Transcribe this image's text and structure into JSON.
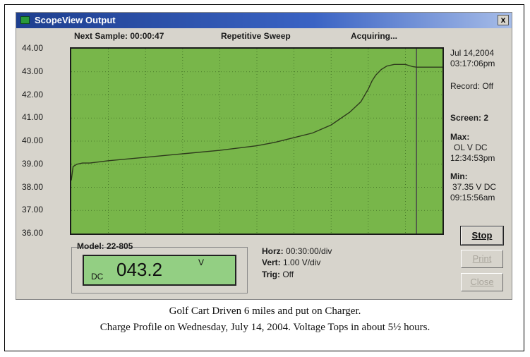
{
  "window": {
    "title": "ScopeView Output",
    "close_label": "x"
  },
  "status": {
    "next_sample": "Next Sample: 00:00:47",
    "mode": "Repetitive Sweep",
    "state": "Acquiring..."
  },
  "y_ticks": [
    "44.00",
    "43.00",
    "42.00",
    "41.00",
    "40.00",
    "39.00",
    "38.00",
    "37.00",
    "36.00"
  ],
  "side_panel": {
    "date": "Jul 14,2004",
    "time": "03:17:06pm",
    "record": "Record: Off",
    "screen": "Screen:  2",
    "max_label": "Max:",
    "max_value": "OL   V DC",
    "max_time": "12:34:53pm",
    "min_label": "Min:",
    "min_value": "37.35   V DC",
    "min_time": "09:15:56am"
  },
  "meter": {
    "model_label": "Model: 22-805",
    "mode": "DC",
    "reading": "043.2",
    "unit": "V"
  },
  "settings": {
    "horz_label": "Horz:",
    "horz_value": "00:30:00/div",
    "vert_label": "Vert:",
    "vert_value": "1.00 V/div",
    "trig_label": "Trig:",
    "trig_value": "Off"
  },
  "buttons": {
    "stop": "Stop",
    "print": "Print",
    "close": "Close"
  },
  "caption": {
    "line1": "Golf Cart Driven 6 miles and put on Charger.",
    "line2": "Charge Profile on Wednesday, July 14, 2004.  Voltage Tops in about 5½ hours."
  },
  "colors": {
    "plot_bg": "#78b64a",
    "trace": "#2e3a1c",
    "lcd_bg": "#93cf83",
    "titlebar": "#1e3f8f"
  },
  "chart_data": {
    "type": "line",
    "ylim": [
      36,
      44
    ],
    "x_divisions": 10,
    "y_divisions": 8,
    "x_unit": "div (00:30:00/div)",
    "series": [
      {
        "x": [
          0,
          0.05,
          0.15,
          0.3,
          0.5,
          1,
          2,
          3,
          4,
          5,
          5.5,
          6,
          6.5,
          7,
          7.5,
          7.8,
          8.0,
          8.1,
          8.2,
          8.35,
          8.5,
          8.7,
          9.0,
          9.2,
          9.3,
          9.6,
          10.0
        ],
        "y": [
          38.3,
          38.9,
          39.0,
          39.05,
          39.05,
          39.15,
          39.3,
          39.45,
          39.6,
          39.8,
          39.95,
          40.15,
          40.35,
          40.7,
          41.25,
          41.7,
          42.25,
          42.6,
          42.85,
          43.1,
          43.25,
          43.32,
          43.32,
          43.22,
          43.2,
          43.2,
          43.2
        ]
      }
    ],
    "cursor_x": 9.3
  }
}
